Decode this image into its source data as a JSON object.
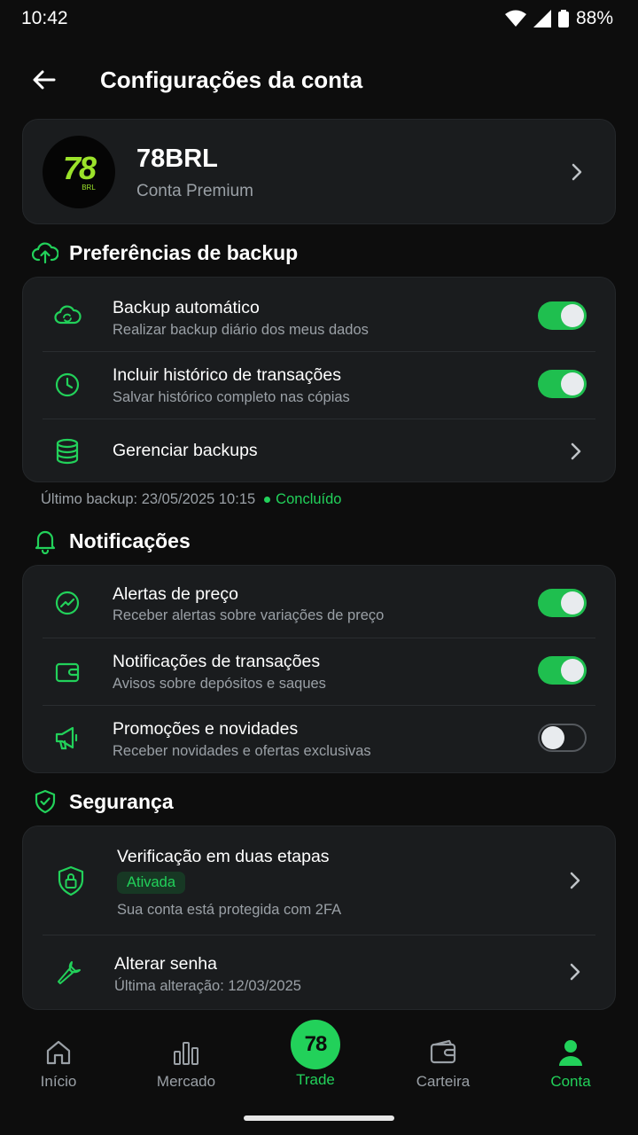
{
  "status_bar": {
    "time": "10:42",
    "battery": "88%"
  },
  "header": {
    "title": "Configurações da conta"
  },
  "profile": {
    "logo_text": "78",
    "logo_sub": "BRL",
    "name": "78BRL",
    "plan": "Conta Premium"
  },
  "backup": {
    "title": "Preferências de backup",
    "rows": [
      {
        "title": "Backup automático",
        "subtitle": "Realizar backup diário dos meus dados",
        "toggle": true
      },
      {
        "title": "Incluir histórico de transações",
        "subtitle": "Salvar histórico completo nas cópias",
        "toggle": true
      },
      {
        "title": "Gerenciar backups"
      }
    ],
    "last_backup": "Último backup: 23/05/2025 10:15",
    "last_status": "Concluído"
  },
  "notifications": {
    "title": "Notificações",
    "rows": [
      {
        "title": "Alertas de preço",
        "subtitle": "Receber alertas sobre variações de preço",
        "toggle": true
      },
      {
        "title": "Notificações de transações",
        "subtitle": "Avisos sobre depósitos e saques",
        "toggle": true
      },
      {
        "title": "Promoções e novidades",
        "subtitle": "Receber novidades e ofertas exclusivas",
        "toggle": false
      }
    ]
  },
  "security": {
    "title": "Segurança",
    "rows": [
      {
        "title": "Verificação em duas etapas",
        "badge": "Ativada",
        "subtitle": "Sua conta está protegida com 2FA"
      },
      {
        "title": "Alterar senha",
        "subtitle": "Última alteração: 12/03/2025"
      }
    ]
  },
  "nav": {
    "items": [
      {
        "label": "Início",
        "icon": "home-icon"
      },
      {
        "label": "Mercado",
        "icon": "chart-bars-icon"
      },
      {
        "label": "Trade",
        "icon": "trade-logo",
        "badge_text": "78"
      },
      {
        "label": "Carteira",
        "icon": "wallet-icon"
      },
      {
        "label": "Conta",
        "icon": "person-icon",
        "active": true
      }
    ]
  },
  "colors": {
    "accent": "#22d15a",
    "background": "#0d0d0d",
    "card": "#1a1c1e"
  }
}
